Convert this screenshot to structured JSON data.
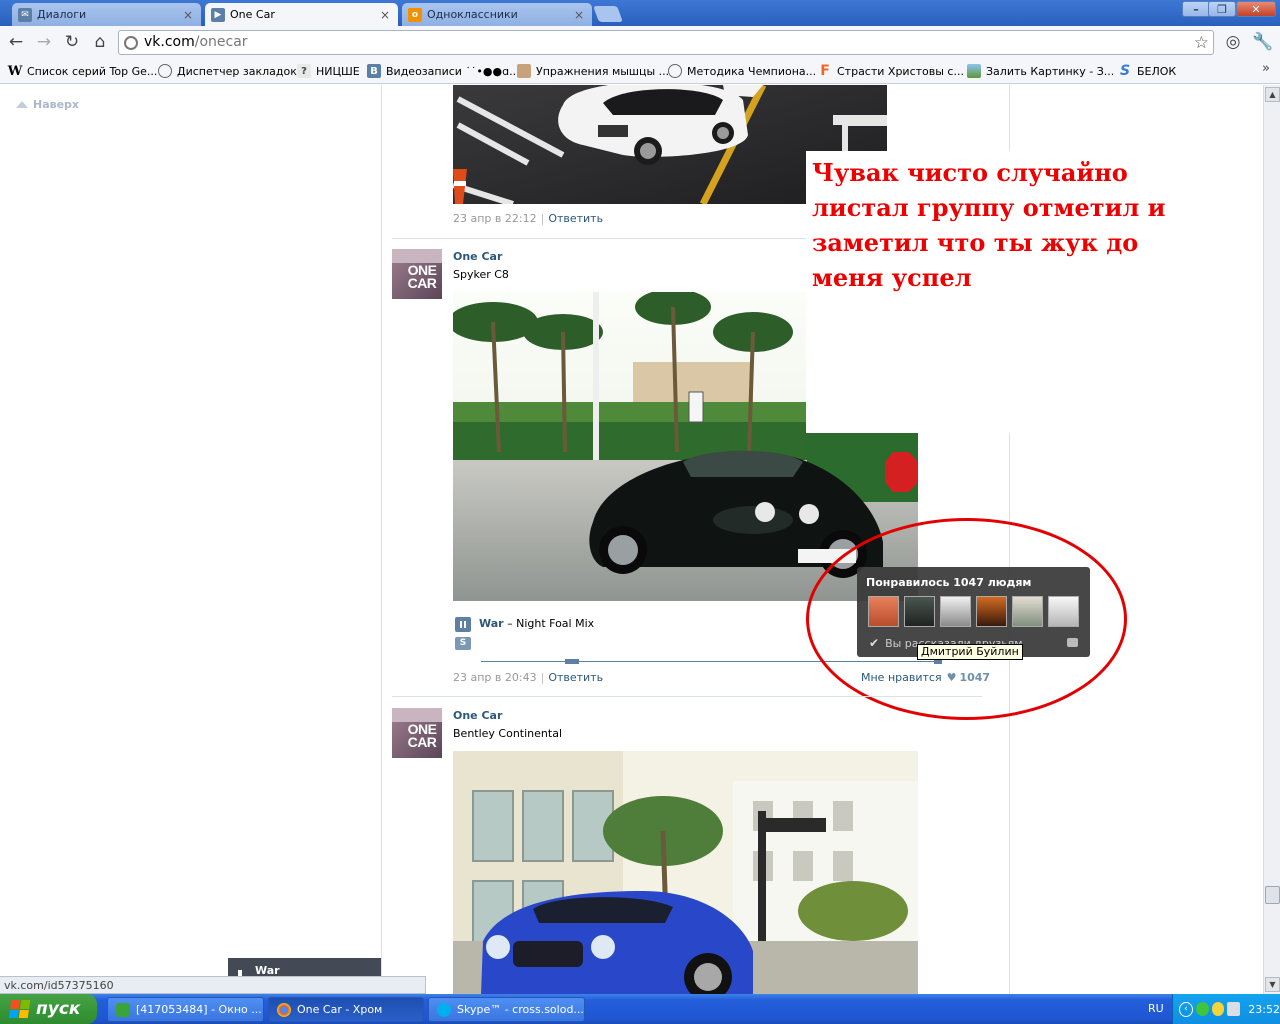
{
  "browser": {
    "tabs": [
      {
        "label": "Диалоги",
        "icon": "vk-message-icon",
        "active": false
      },
      {
        "label": "One Car",
        "icon": "vk-play-icon",
        "active": true
      },
      {
        "label": "Одноклассники",
        "icon": "odnoklassniki-icon",
        "active": false
      }
    ],
    "tab_close": "×",
    "window_controls": {
      "minimize": "–",
      "maximize": "❐",
      "close": "✕"
    },
    "url_host": "vk.com",
    "url_path": "/onecar",
    "bookmarks": [
      {
        "label": "Список серий Top Ge...",
        "icon": "wikipedia-icon"
      },
      {
        "label": "Диспетчер закладок",
        "icon": "globe-icon"
      },
      {
        "label": "НИЦШЕ",
        "icon": "question-icon"
      },
      {
        "label": "Видеозаписи ˙˙•●●ɑ...",
        "icon": "vk-icon"
      },
      {
        "label": "Упражнения мышцы ...",
        "icon": "athlete-icon"
      },
      {
        "label": "Методика Чемпиона...",
        "icon": "globe-icon"
      },
      {
        "label": "Страсти Христовы с...",
        "icon": "f-letter-icon"
      },
      {
        "label": "Залить Картинку - З...",
        "icon": "landscape-icon"
      },
      {
        "label": "БЕЛОК",
        "icon": "s-letter-icon"
      }
    ],
    "bookmarks_more": "»",
    "status_url": "vk.com/id57375160"
  },
  "page": {
    "back_to_top": "Наверх",
    "post1": {
      "date": "23 апр в 22:12",
      "reply": "Ответить"
    },
    "post2": {
      "author": "One Car",
      "text": "Spyker C8",
      "audio_artist": "War",
      "audio_title": "Night Foal Mix",
      "audio_sep": " – ",
      "s_badge": "S",
      "date": "23 апр в 20:43",
      "reply": "Ответить",
      "like_label": "Мне нравится",
      "like_count": "1047"
    },
    "post3": {
      "author": "One Car",
      "text": "Bentley Continental"
    },
    "avatar_text": "ONE CAR",
    "like_popup": {
      "title": "Понравилось 1047 людям",
      "note": "Вы рассказали друзьям",
      "tooltip": "Дмитрий Буйлин"
    },
    "annotation": "Чувак чисто случайно листал группу отметил и заметил что ты жук до меня успел",
    "mini_player_title": "War"
  },
  "taskbar": {
    "start_label": "пуск",
    "buttons": [
      {
        "label": "[417053484] - Окно ...",
        "active": false
      },
      {
        "label": "One Car - Хром",
        "active": true
      },
      {
        "label": "Skype™ - cross.solod...",
        "active": false
      }
    ],
    "lang": "RU",
    "clock": "23:52"
  },
  "colors": {
    "vk_link": "#2b587a",
    "annotation_red": "#ec0000",
    "xp_blue": "#245edb",
    "xp_start_green": "#3b9a3b"
  }
}
